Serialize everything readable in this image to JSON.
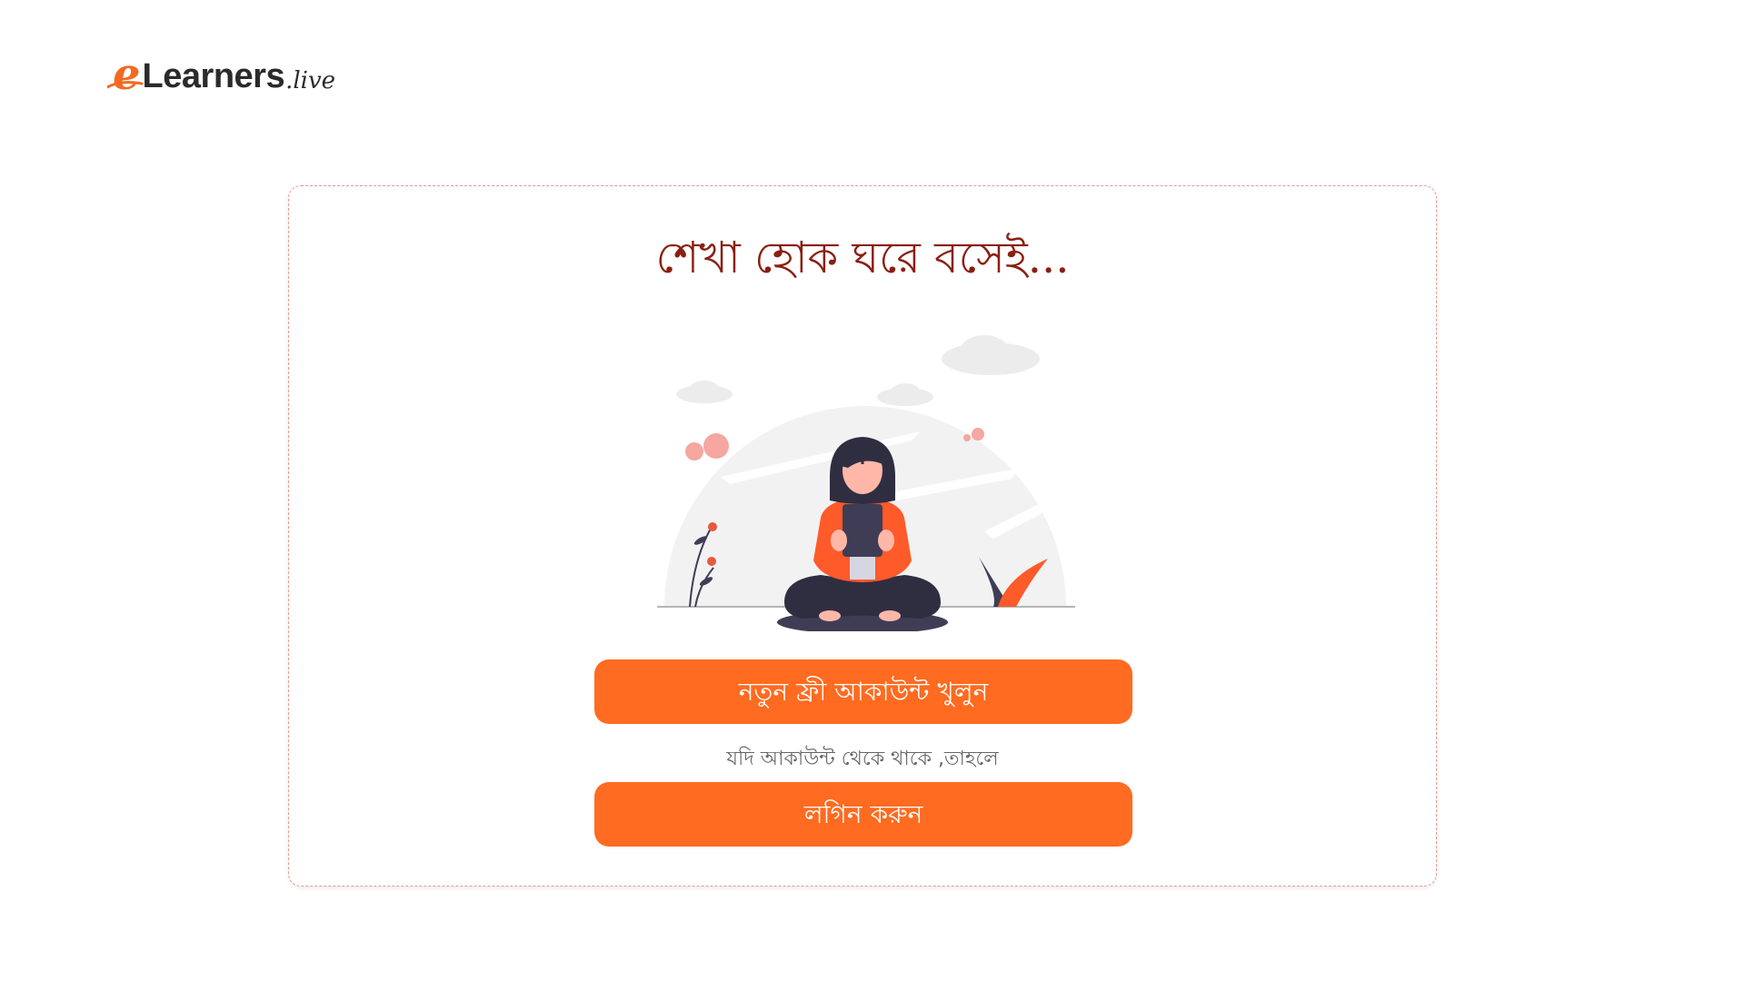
{
  "logo": {
    "letter": "e",
    "main": "Learners",
    "suffix": ".live"
  },
  "card": {
    "headline": "শেখা হোক ঘরে বসেই...",
    "signup_button": "নতুন ফ্রী আকাউন্ট খুলুন",
    "hint": "যদি আকাউন্ট থেকে থাকে ,তাহলে",
    "login_button": "লগিন করুন"
  },
  "colors": {
    "accent": "#ff6b20",
    "headline": "#8a1f12",
    "card_border": "#e59a8e"
  },
  "illustration": {
    "icon": "person-with-phone-illustration"
  }
}
